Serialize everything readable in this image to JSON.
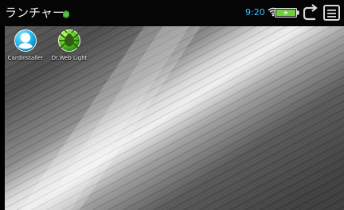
{
  "statusbar": {
    "title": "ランチャー",
    "time": "9:20",
    "icons": [
      "android-icon",
      "wifi-icon",
      "battery-icon",
      "back-icon",
      "menu-icon"
    ],
    "accent_color": "#48c2ff",
    "battery_color": "#6ecf3a"
  },
  "desktop": {
    "shortcuts": [
      {
        "label": "CardInstaller",
        "icon": "cardinstaller-icon"
      },
      {
        "label": "Dr.Web Light",
        "icon": "drweb-spider-icon"
      }
    ]
  }
}
